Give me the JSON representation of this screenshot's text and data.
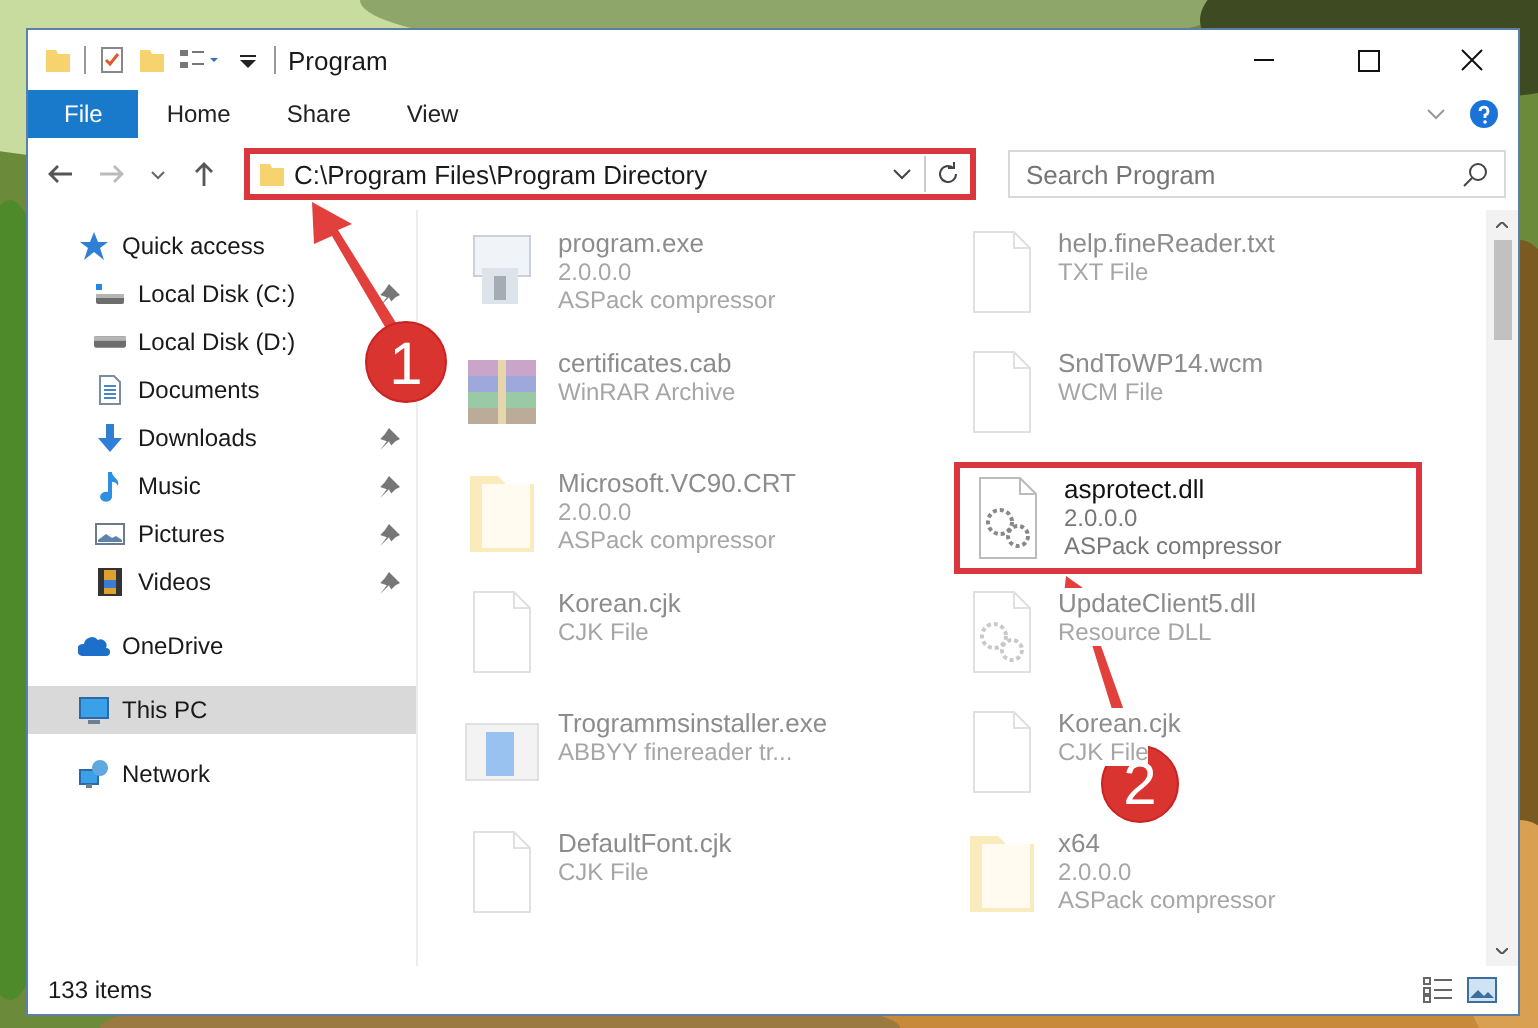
{
  "window": {
    "title": "Program"
  },
  "ribbon": {
    "tabs": [
      {
        "label": "File",
        "selected": true
      },
      {
        "label": "Home",
        "selected": false
      },
      {
        "label": "Share",
        "selected": false
      },
      {
        "label": "View",
        "selected": false
      }
    ]
  },
  "address_bar": {
    "path": "C:\\Program Files\\Program Directory",
    "highlighted": true
  },
  "search": {
    "placeholder": "Search Program"
  },
  "sidebar": {
    "items": [
      {
        "label": "Quick access",
        "kind": "star",
        "selected": false,
        "children": [
          {
            "label": "Local Disk (C:)",
            "kind": "disk-c",
            "pinned": true
          },
          {
            "label": "Local Disk (D:)",
            "kind": "disk",
            "pinned": false
          },
          {
            "label": "Documents",
            "kind": "documents",
            "pinned": false
          },
          {
            "label": "Downloads",
            "kind": "downloads",
            "pinned": true
          },
          {
            "label": "Music",
            "kind": "music",
            "pinned": true
          },
          {
            "label": "Pictures",
            "kind": "pictures",
            "pinned": true
          },
          {
            "label": "Videos",
            "kind": "videos",
            "pinned": true
          }
        ]
      },
      {
        "label": "OneDrive",
        "kind": "cloud",
        "selected": false
      },
      {
        "label": "This PC",
        "kind": "pc",
        "selected": true
      },
      {
        "label": "Network",
        "kind": "network",
        "selected": false
      }
    ]
  },
  "files": [
    {
      "name": "program.exe",
      "details": [
        "2.0.0.0",
        "ASPack compressor"
      ],
      "kind": "exe",
      "faded": true,
      "highlighted": false
    },
    {
      "name": "help.fineReader.txt",
      "details": [
        "TXT File"
      ],
      "kind": "file",
      "faded": true,
      "highlighted": false
    },
    {
      "name": "certificates.cab",
      "details": [
        "WinRAR Archive"
      ],
      "kind": "archive",
      "faded": true,
      "highlighted": false
    },
    {
      "name": "SndToWP14.wcm",
      "details": [
        "WCM File"
      ],
      "kind": "file",
      "faded": true,
      "highlighted": false
    },
    {
      "name": "Microsoft.VC90.CRT",
      "details": [
        "2.0.0.0",
        "ASPack compressor"
      ],
      "kind": "folder",
      "faded": true,
      "highlighted": false
    },
    {
      "name": "asprotect.dll",
      "details": [
        "2.0.0.0",
        "ASPack compressor"
      ],
      "kind": "dll",
      "faded": false,
      "highlighted": true
    },
    {
      "name": "Korean.cjk",
      "details": [
        "CJK File"
      ],
      "kind": "file",
      "faded": true,
      "highlighted": false
    },
    {
      "name": "UpdateClient5.dll",
      "details": [
        "Resource DLL"
      ],
      "kind": "dll",
      "faded": true,
      "highlighted": false
    },
    {
      "name": "Trogrammsinstaller.exe",
      "details": [
        "ABBYY finereader tr..."
      ],
      "kind": "installer",
      "faded": true,
      "highlighted": false
    },
    {
      "name": "Korean.cjk",
      "details": [
        "CJK File"
      ],
      "kind": "file",
      "faded": true,
      "highlighted": false
    },
    {
      "name": "DefaultFont.cjk",
      "details": [
        "CJK File"
      ],
      "kind": "file",
      "faded": true,
      "highlighted": false
    },
    {
      "name": "x64",
      "details": [
        "2.0.0.0",
        "ASPack compressor"
      ],
      "kind": "folder",
      "faded": true,
      "highlighted": false
    }
  ],
  "annotations": [
    {
      "label": "1"
    },
    {
      "label": "2"
    }
  ],
  "status_bar": {
    "count": "133 items"
  }
}
